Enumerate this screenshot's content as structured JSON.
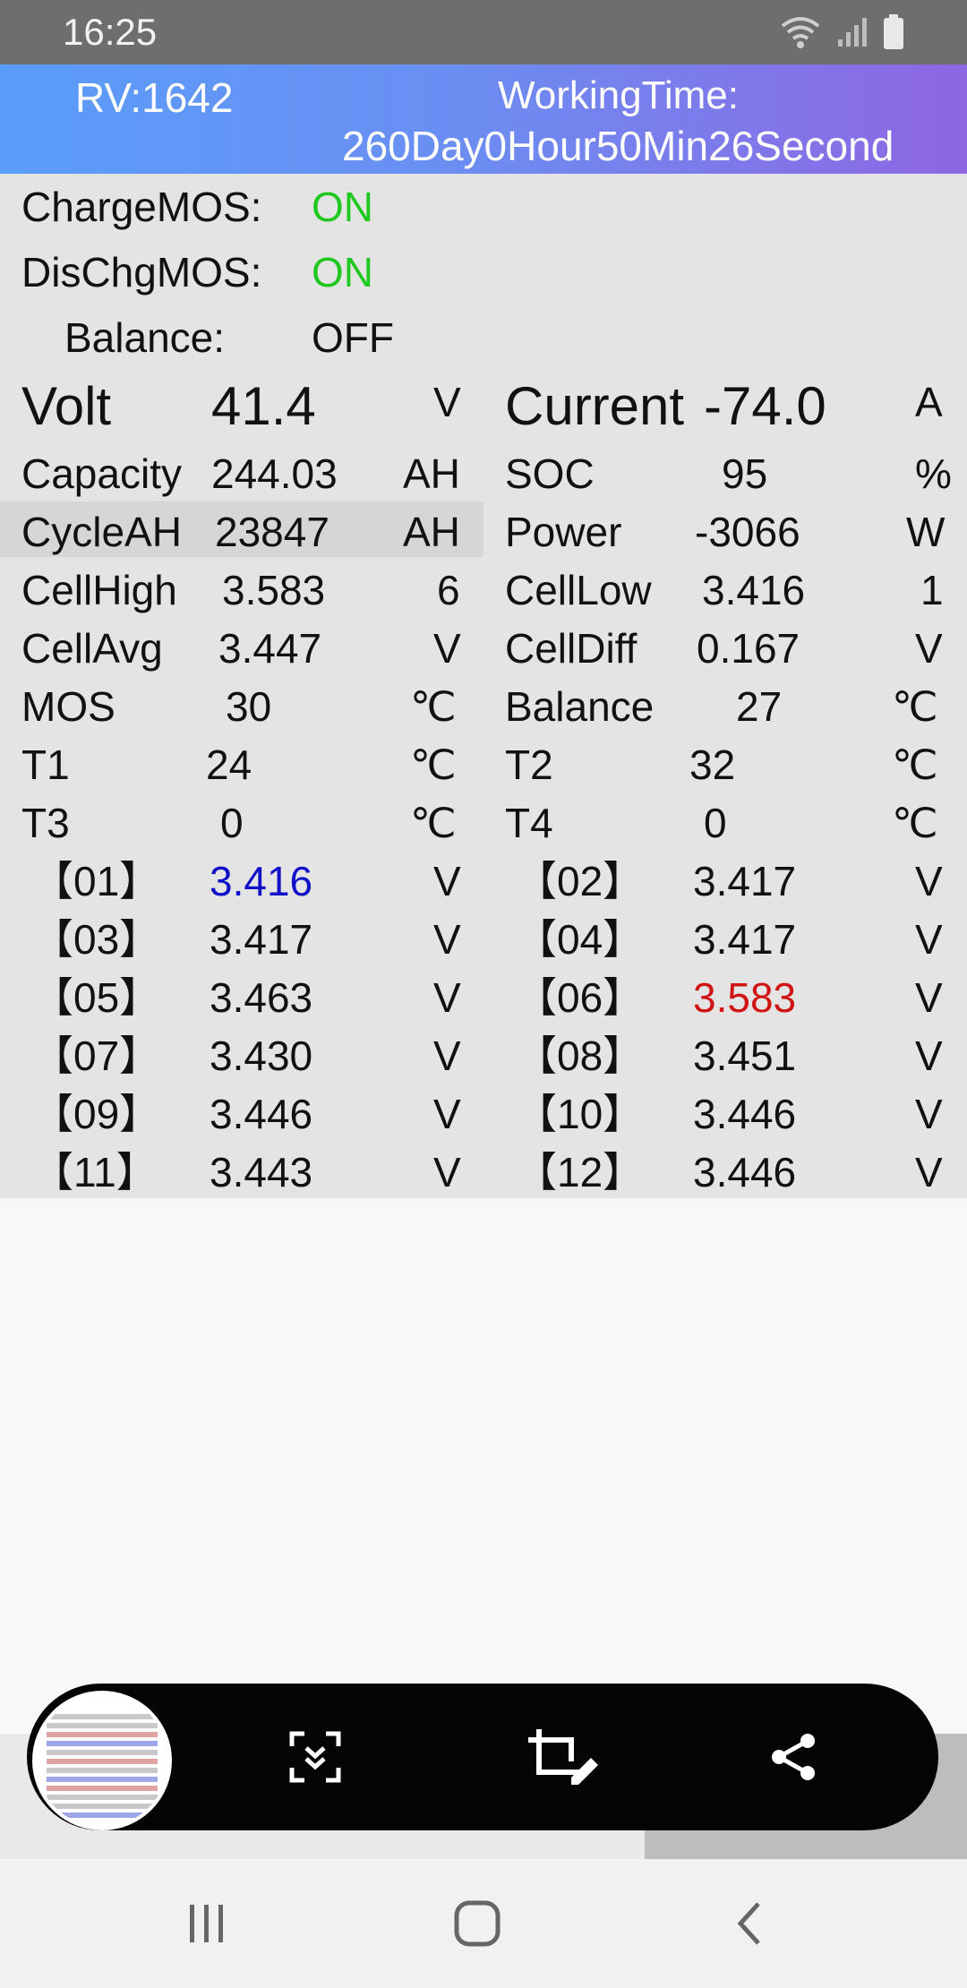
{
  "status_bar": {
    "time": "16:25"
  },
  "header": {
    "rv": "RV:1642",
    "working_time_label": "WorkingTime:",
    "working_time_value": "260Day0Hour50Min26Second"
  },
  "mos": {
    "charge_label": "ChargeMOS:",
    "charge_value": "ON",
    "discharge_label": "DisChgMOS:",
    "discharge_value": "ON",
    "balance_label": "Balance:",
    "balance_value": "OFF"
  },
  "metrics": {
    "volt": {
      "label": "Volt",
      "value": "41.4",
      "unit": "V"
    },
    "current": {
      "label": "Current",
      "value": "-74.0",
      "unit": "A"
    },
    "capacity": {
      "label": "Capacity",
      "value": "244.03",
      "unit": "AH"
    },
    "soc": {
      "label": "SOC",
      "value": "95",
      "unit": "%"
    },
    "cycle_ah": {
      "label": "CycleAH",
      "value": "23847",
      "unit": "AH"
    },
    "power": {
      "label": "Power",
      "value": "-3066",
      "unit": "W"
    },
    "cell_high": {
      "label": "CellHigh",
      "value": "3.583",
      "unit": "6"
    },
    "cell_low": {
      "label": "CellLow",
      "value": "3.416",
      "unit": "1"
    },
    "cell_avg": {
      "label": "CellAvg",
      "value": "3.447",
      "unit": "V"
    },
    "cell_diff": {
      "label": "CellDiff",
      "value": "0.167",
      "unit": "V"
    },
    "mos_temp": {
      "label": "MOS",
      "value": "30",
      "unit": "℃"
    },
    "balance_temp": {
      "label": "Balance",
      "value": "27",
      "unit": "℃"
    },
    "t1": {
      "label": "T1",
      "value": "24",
      "unit": "℃"
    },
    "t2": {
      "label": "T2",
      "value": "32",
      "unit": "℃"
    },
    "t3": {
      "label": "T3",
      "value": "0",
      "unit": "℃"
    },
    "t4": {
      "label": "T4",
      "value": "0",
      "unit": "℃"
    }
  },
  "cells": [
    {
      "label": "【01】",
      "value": "3.416",
      "unit": "V"
    },
    {
      "label": "【02】",
      "value": "3.417",
      "unit": "V"
    },
    {
      "label": "【03】",
      "value": "3.417",
      "unit": "V"
    },
    {
      "label": "【04】",
      "value": "3.417",
      "unit": "V"
    },
    {
      "label": "【05】",
      "value": "3.463",
      "unit": "V"
    },
    {
      "label": "【06】",
      "value": "3.583",
      "unit": "V"
    },
    {
      "label": "【07】",
      "value": "3.430",
      "unit": "V"
    },
    {
      "label": "【08】",
      "value": "3.451",
      "unit": "V"
    },
    {
      "label": "【09】",
      "value": "3.446",
      "unit": "V"
    },
    {
      "label": "【10】",
      "value": "3.446",
      "unit": "V"
    },
    {
      "label": "【11】",
      "value": "3.443",
      "unit": "V"
    },
    {
      "label": "【12】",
      "value": "3.446",
      "unit": "V"
    }
  ],
  "colors": {
    "on": "#1fc81f",
    "lowest_cell": "#1010c8",
    "highest_cell": "#d01414",
    "header_start": "#5a9df9",
    "header_end": "#8e67e3"
  },
  "screenshot_toolbar": {
    "icons": [
      "scroll-capture-icon",
      "crop-edit-icon",
      "share-icon"
    ]
  },
  "nav_bar": {
    "icons": [
      "recent-apps-icon",
      "home-icon",
      "back-icon"
    ]
  }
}
